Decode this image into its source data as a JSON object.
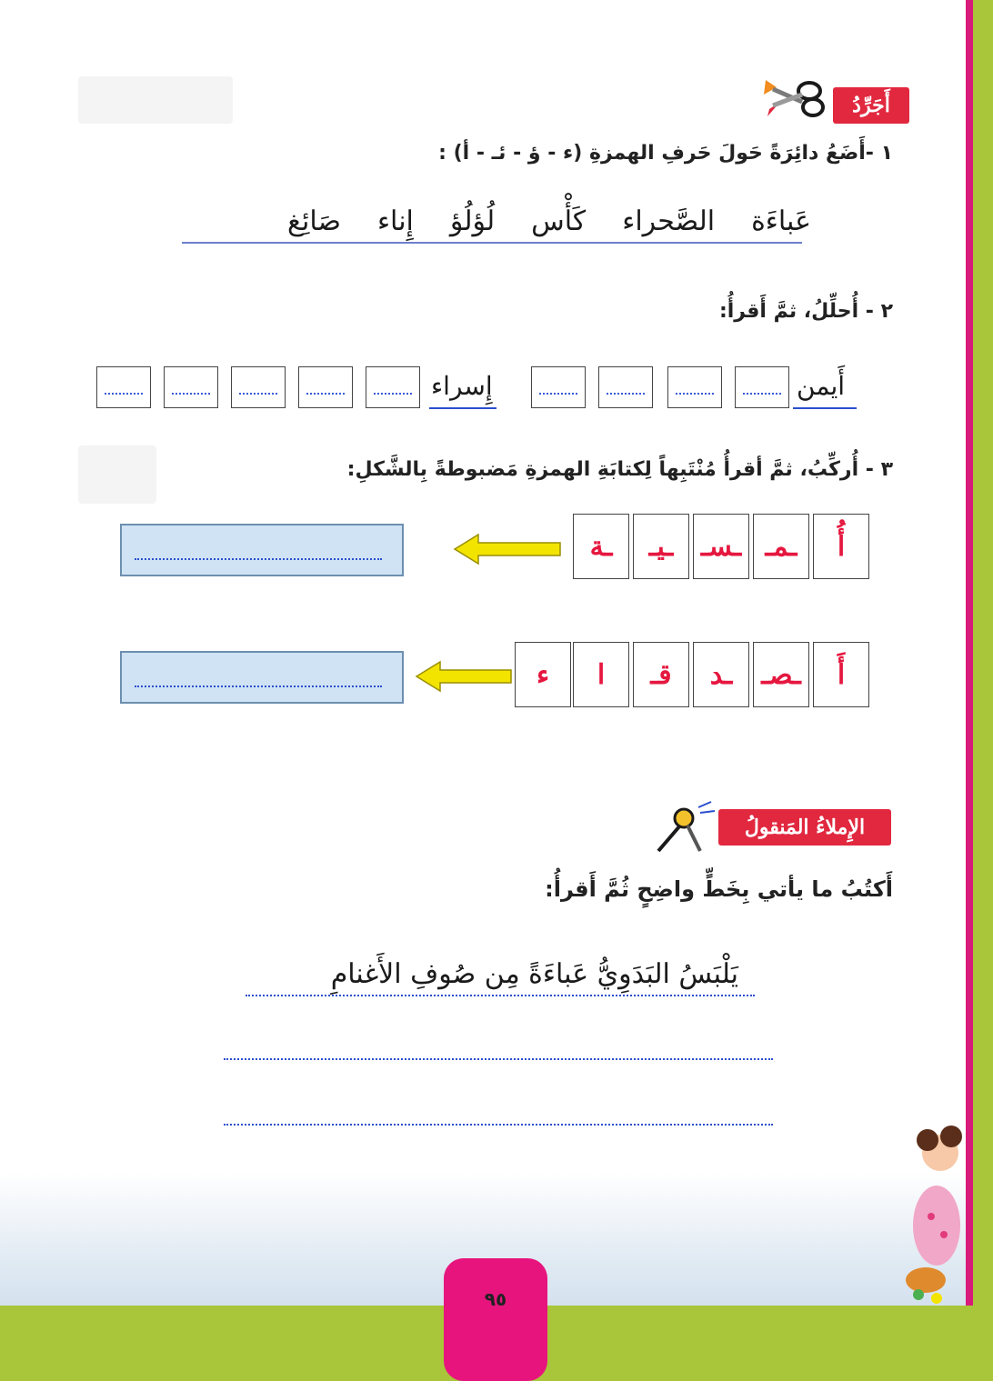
{
  "section1": {
    "badge": "أَجَرِّدُ",
    "q1": "١ -أَضَعُ دائِرَةً حَولَ حَرفِ الهمزةِ (ء - ؤ - ئـ - أ) :",
    "words": [
      "عَباءَة",
      "الصَّحراء",
      "كَأْس",
      "لُؤلُؤ",
      "إِناء",
      "صَائِغ"
    ],
    "q2": "٢ - أُحلِّلُ، ثمَّ أَقرأُ:",
    "q2_words": [
      "أَيمن",
      "إِسراء"
    ],
    "q3": "٣ - أُركِّبُ، ثمَّ أقرأُ مُنْتَبِهاً لِكتابَةِ الهمزةِ مَضبوطةً بِالشَّكلِ:",
    "row1_letters": [
      "أُ",
      "ـمـ",
      "ـسـ",
      "ـيـ",
      "ـة"
    ],
    "row2_letters": [
      "أَ",
      "ـصـ",
      "ـد",
      "قـ",
      "ا",
      "ء"
    ]
  },
  "section2": {
    "badge": "الإِملاءُ المَنقولُ",
    "instruction": "أَكتُبُ ما يأتي بِخَطٍّ واضِحٍ ثُمَّ أَقرأُ:",
    "sentence": "يَلْبَسُ البَدَوِيُّ عَباءَةً مِن صُوفِ الأَغنامِ"
  },
  "page_number": "٩٥",
  "colors": {
    "badge_red": "#e1283f",
    "page_pink": "#e8147e",
    "frame_green": "#a9c53a",
    "letter_red": "#e5173f",
    "answer_blue": "#cfe3f4",
    "arrow_yellow": "#f3e400"
  },
  "icons": [
    "scissors-icon",
    "compass-icon",
    "arrow-left-icon",
    "girl-illustration"
  ]
}
